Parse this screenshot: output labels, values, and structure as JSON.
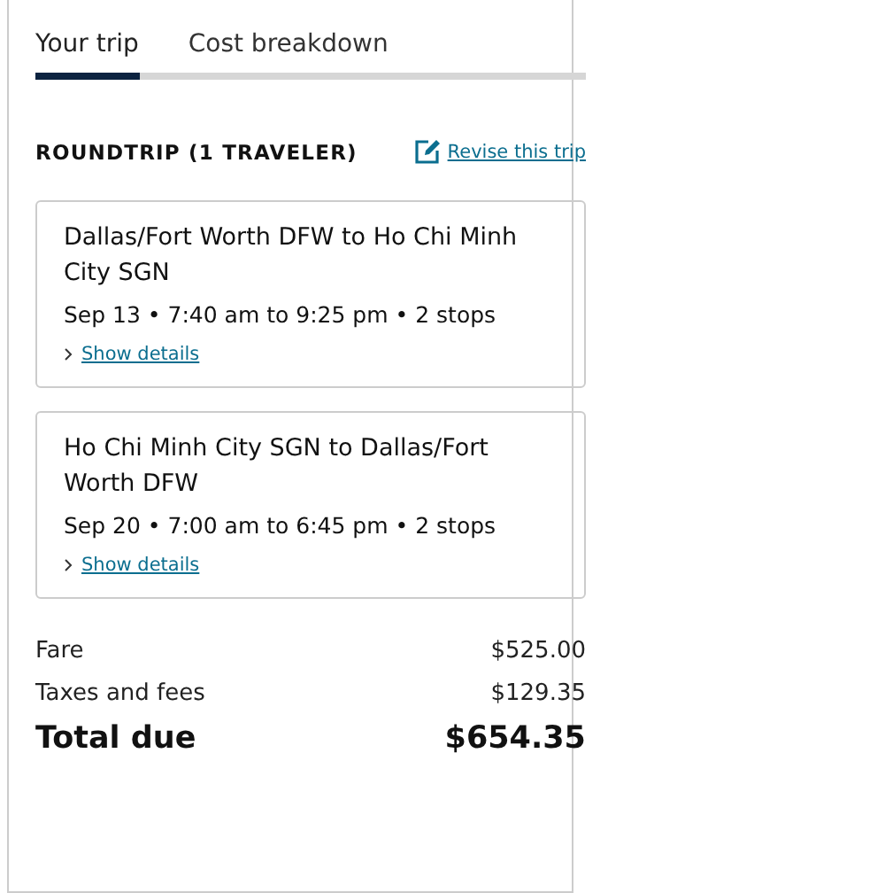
{
  "tabs": [
    {
      "label": "Your trip",
      "selected": true
    },
    {
      "label": "Cost breakdown",
      "selected": false
    }
  ],
  "trip_heading": "ROUNDTRIP (1 TRAVELER)",
  "revise_link": "Revise this trip",
  "flights": [
    {
      "route": "Dallas/Fort Worth DFW to Ho Chi Minh City SGN",
      "summary": "Sep 13 • 7:40 am to 9:25 pm • 2 stops",
      "details_link": "Show details"
    },
    {
      "route": "Ho Chi Minh City SGN to Dallas/Fort Worth DFW",
      "summary": "Sep 20 • 7:00 am to 6:45 pm • 2 stops",
      "details_link": "Show details"
    }
  ],
  "costs": [
    {
      "kind": "line",
      "label": "Fare",
      "amount": "$525.00"
    },
    {
      "kind": "line",
      "label": "Taxes and fees",
      "amount": "$129.35"
    },
    {
      "kind": "total",
      "label": "Total due",
      "amount": "$654.35"
    }
  ]
}
